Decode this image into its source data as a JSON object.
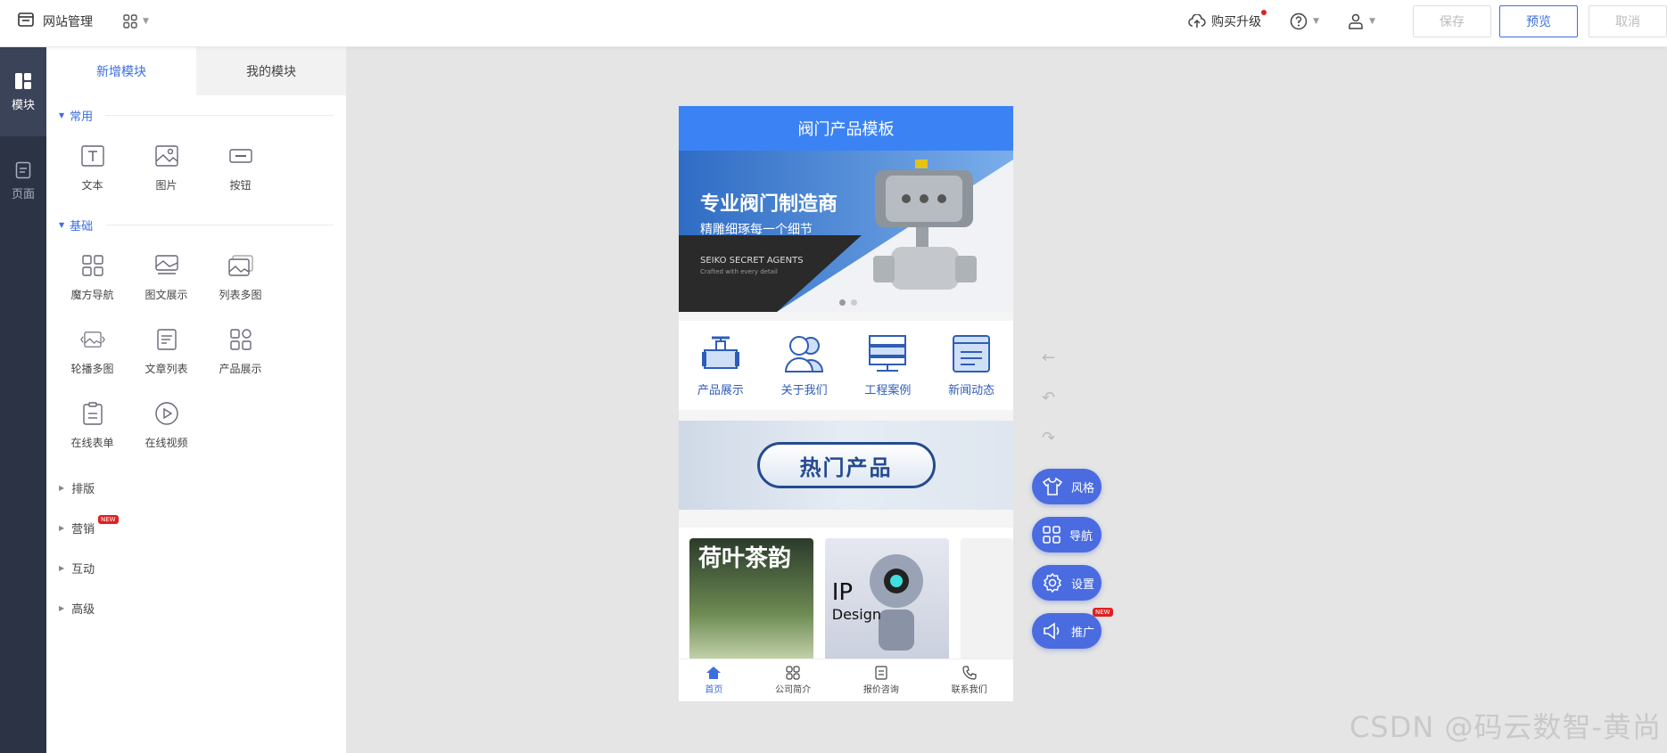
{
  "topbar": {
    "title": "网站管理",
    "upgrade": "购买升级",
    "save": "保存",
    "preview": "预览",
    "cancel": "取消"
  },
  "rail": {
    "items": [
      {
        "label": "模块"
      },
      {
        "label": "页面"
      }
    ]
  },
  "panel": {
    "tabs": [
      "新增模块",
      "我的模块"
    ],
    "sections": [
      {
        "title": "常用",
        "items": [
          "文本",
          "图片",
          "按钮"
        ]
      },
      {
        "title": "基础",
        "items": [
          "魔方导航",
          "图文展示",
          "列表多图",
          "轮播多图",
          "文章列表",
          "产品展示",
          "在线表单",
          "在线视频"
        ]
      }
    ],
    "collapsed": [
      "排版",
      "营销",
      "互动",
      "高级"
    ],
    "new_badge": "NEW"
  },
  "phone": {
    "header": "阀门产品模板",
    "banner": {
      "title": "专业阀门制造商",
      "subtitle": "精雕细琢每一个细节",
      "agent": "SEIKO SECRET AGENTS",
      "craft": "Crafted with every detail"
    },
    "nav": [
      "产品展示",
      "关于我们",
      "工程案例",
      "新闻动态"
    ],
    "hot": "热门产品",
    "products": [
      {
        "title": "荷叶茶韵"
      },
      {
        "title1": "IP",
        "title2": "Design"
      }
    ],
    "tabbar": [
      "首页",
      "公司简介",
      "报价咨询",
      "联系我们"
    ]
  },
  "fab": [
    "风格",
    "导航",
    "设置",
    "推广"
  ],
  "watermark": "CSDN @码云数智-黄尚",
  "colors": {
    "accent": "#3b6fe0",
    "fab": "#4a6ce0",
    "rail": "#2b3345",
    "phone_header": "#3b83f5"
  }
}
